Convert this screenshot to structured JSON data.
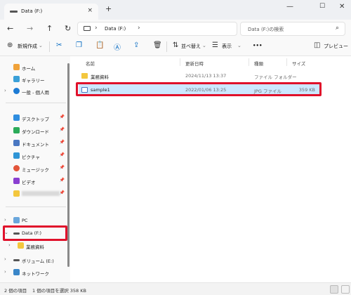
{
  "tab": {
    "title": "Data (F:)"
  },
  "window_controls": {
    "minimize": "—",
    "maximize": "☐",
    "close": "✕"
  },
  "nav": {
    "back": "←",
    "forward": "→",
    "up": "↑",
    "refresh": "↻"
  },
  "address": {
    "path": "Data (F:)",
    "separator": "›"
  },
  "search": {
    "placeholder": "Data (F:)の検索"
  },
  "toolbar": {
    "new_label": "新規作成",
    "sort_label": "並べ替え",
    "view_label": "表示",
    "more_label": "•••",
    "preview_label": "プレビュー"
  },
  "sidebar": {
    "items": [
      {
        "label": "ホーム"
      },
      {
        "label": "ギャラリー"
      },
      {
        "label": "一般 - 個人用"
      },
      {
        "label": "デスクトップ"
      },
      {
        "label": "ダウンロード"
      },
      {
        "label": "ドキュメント"
      },
      {
        "label": "ピクチャ"
      },
      {
        "label": "ミュージック"
      },
      {
        "label": "ビデオ"
      },
      {
        "label": "PC"
      },
      {
        "label": "Data (F:)"
      },
      {
        "label": "業務資料"
      },
      {
        "label": "ボリューム (E:)"
      },
      {
        "label": "ネットワーク"
      }
    ]
  },
  "columns": {
    "name": "名前",
    "date": "更新日時",
    "type": "種類",
    "size": "サイズ"
  },
  "files": [
    {
      "name": "業務資料",
      "date": "2024/11/13 13:37",
      "type": "ファイル フォルダー",
      "size": ""
    },
    {
      "name": "sample1",
      "date": "2022/01/06 13:25",
      "type": "JPG ファイル",
      "size": "359 KB"
    }
  ],
  "status": {
    "count": "2 個の項目",
    "selection": "1 個の項目を選択 358 KB"
  },
  "colors": {
    "accent": "#0067c0",
    "highlight_border": "#e0112b",
    "selection": "#cce8ff",
    "folder": "#f3c73e"
  }
}
